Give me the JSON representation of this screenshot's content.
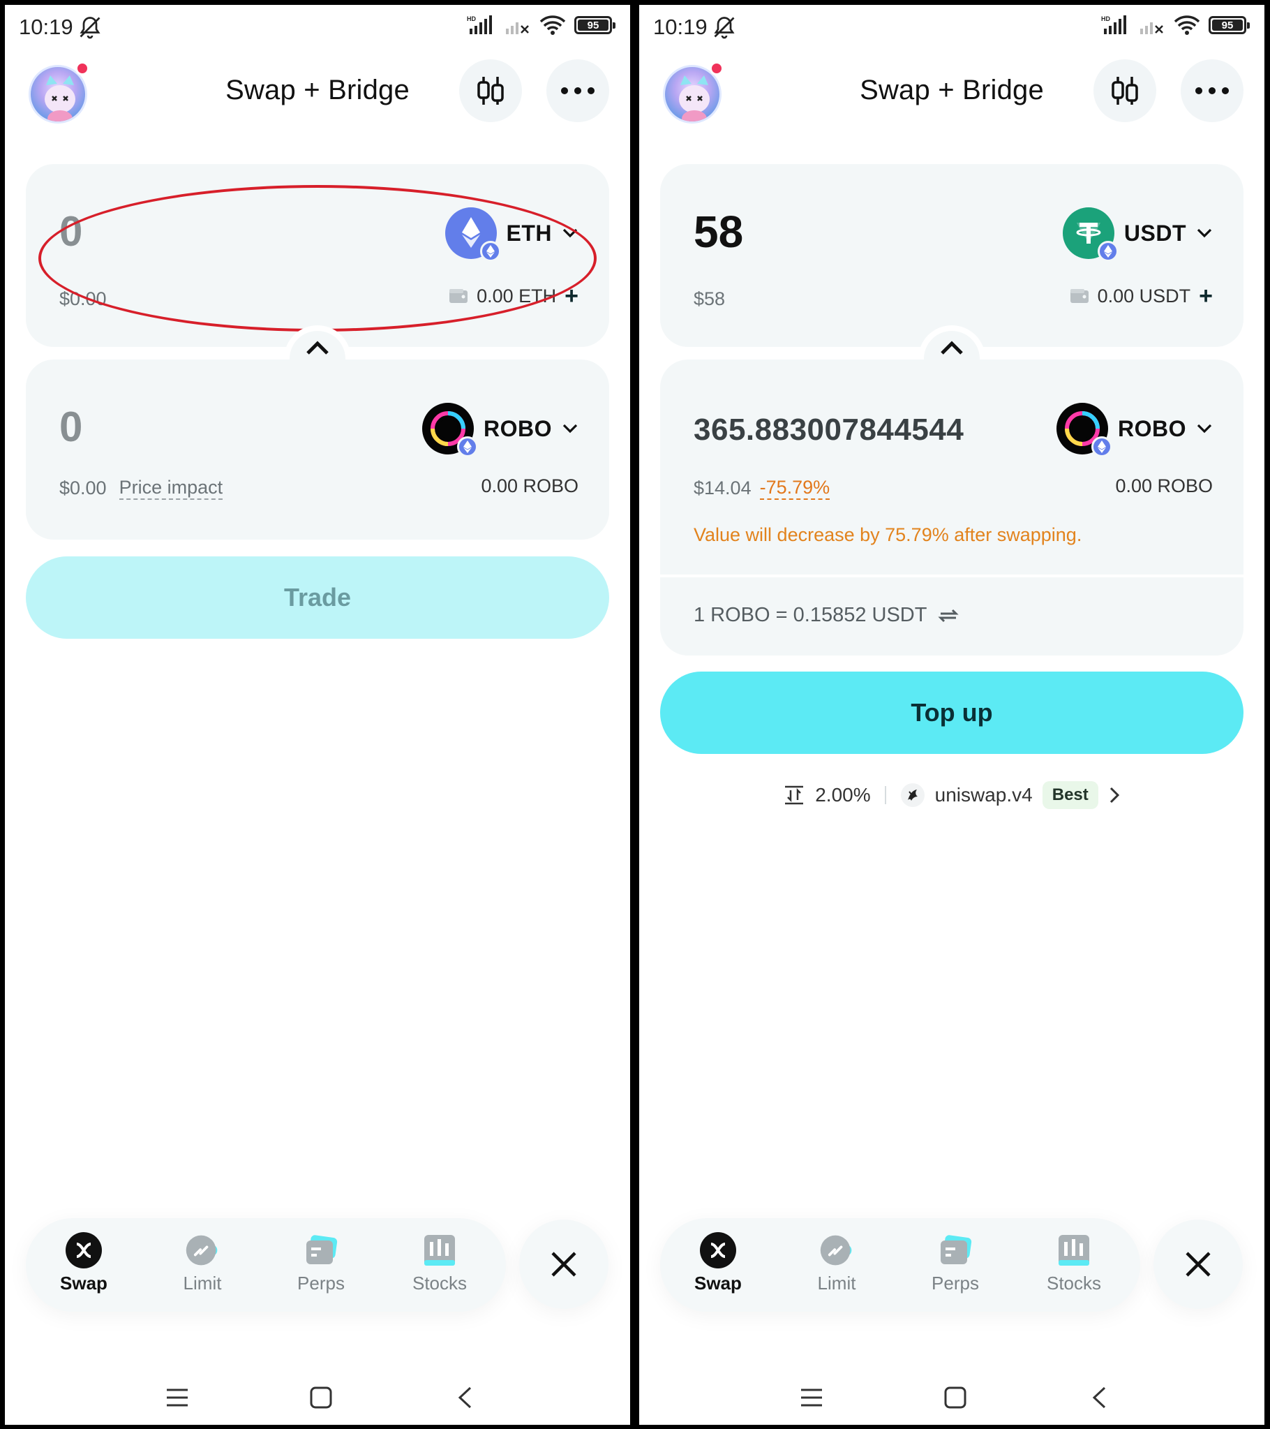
{
  "status_bar": {
    "time": "10:19",
    "battery": "95"
  },
  "header": {
    "title": "Swap + Bridge"
  },
  "left": {
    "from": {
      "amount": "0",
      "usd": "$0.00",
      "token": "ETH",
      "balance": "0.00 ETH"
    },
    "to": {
      "amount": "0",
      "usd": "$0.00",
      "price_impact_label": "Price impact",
      "token": "ROBO",
      "balance": "0.00 ROBO"
    },
    "button_label": "Trade"
  },
  "right": {
    "from": {
      "amount": "58",
      "usd": "$58",
      "token": "USDT",
      "balance": "0.00 USDT"
    },
    "to": {
      "amount": "365.883007844544",
      "usd": "$14.04",
      "impact": "-75.79%",
      "token": "ROBO",
      "balance": "0.00 ROBO",
      "warning": "Value will decrease by 75.79% after swapping."
    },
    "rate": "1 ROBO = 0.15852 USDT",
    "button_label": "Top up",
    "route": {
      "slippage": "2.00%",
      "provider": "uniswap.v4",
      "badge": "Best"
    }
  },
  "tabs": [
    {
      "label": "Swap",
      "active": true
    },
    {
      "label": "Limit",
      "active": false
    },
    {
      "label": "Perps",
      "active": false
    },
    {
      "label": "Stocks",
      "active": false
    }
  ],
  "colors": {
    "accent": "#5ceaf4",
    "trade_disabled": "#bdf5f8",
    "warning": "#e2831d",
    "highlight": "#d71f2a"
  }
}
